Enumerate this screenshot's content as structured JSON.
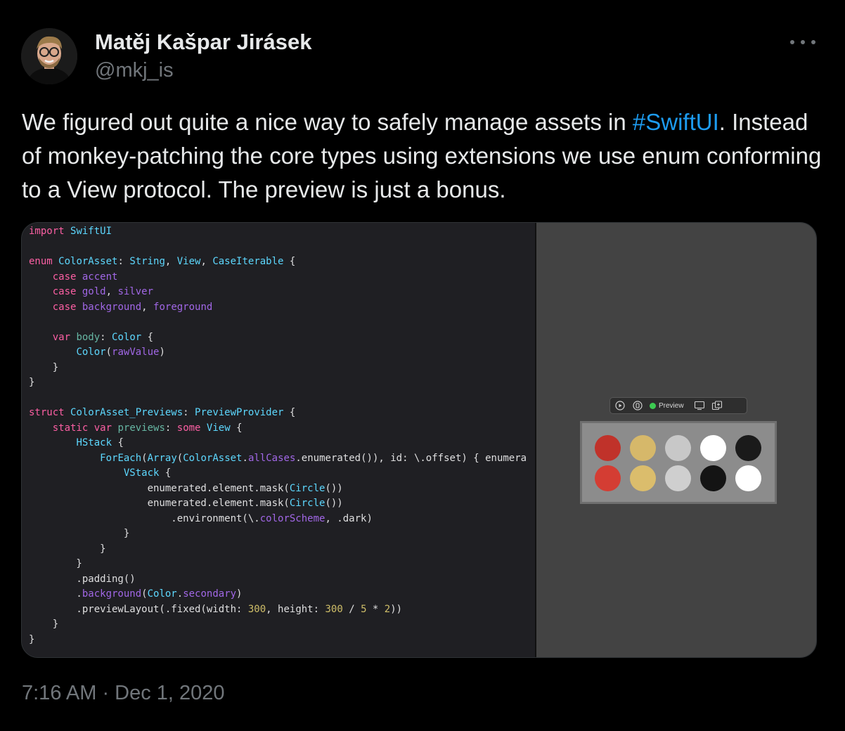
{
  "tweet": {
    "author_name": "Matěj Kašpar Jirásek",
    "author_handle": "@mkj_is",
    "text_before": "We figured out quite a nice way to safely manage assets in ",
    "hashtag": "#SwiftUI",
    "text_after": ". Instead of monkey-patching the core types using extensions we use enum conforming to a View protocol. The preview is just a bonus.",
    "timestamp": "7:16 AM · Dec 1, 2020"
  },
  "icons": {
    "more": "more-horizontal-icon",
    "live": "play-circle-icon",
    "inspect": "inspect-icon",
    "device": "device-icon",
    "duplicate": "duplicate-icon"
  },
  "media": {
    "code_lines": [
      "import SwiftUI",
      "",
      "enum ColorAsset: String, View, CaseIterable {",
      "    case accent",
      "    case gold, silver",
      "    case background, foreground",
      "",
      "    var body: Color {",
      "        Color(rawValue)",
      "    }",
      "}",
      "",
      "struct ColorAsset_Previews: PreviewProvider {",
      "    static var previews: some View {",
      "        HStack {",
      "            ForEach(Array(ColorAsset.allCases.enumerated()), id: \\.offset) { enumera",
      "                VStack {",
      "                    enumerated.element.mask(Circle())",
      "                    enumerated.element.mask(Circle())",
      "                        .environment(\\.colorScheme, .dark)",
      "                }",
      "            }",
      "        }",
      "        .padding()",
      "        .background(Color.secondary)",
      "        .previewLayout(.fixed(width: 300, height: 300 / 5 * 2))",
      "    }",
      "}"
    ],
    "preview": {
      "toolbar_label": "Preview",
      "swatches_light": [
        "#c0322a",
        "#d6b86a",
        "#c8c8c8",
        "#ffffff",
        "#1a1a1a"
      ],
      "swatches_dark": [
        "#d43d33",
        "#dbbd6c",
        "#cfcfcf",
        "#141414",
        "#ffffff"
      ]
    }
  },
  "colors": {
    "background": "#000000",
    "text": "#e7e9ea",
    "secondary_text": "#71767b",
    "link": "#1d9bf0"
  }
}
